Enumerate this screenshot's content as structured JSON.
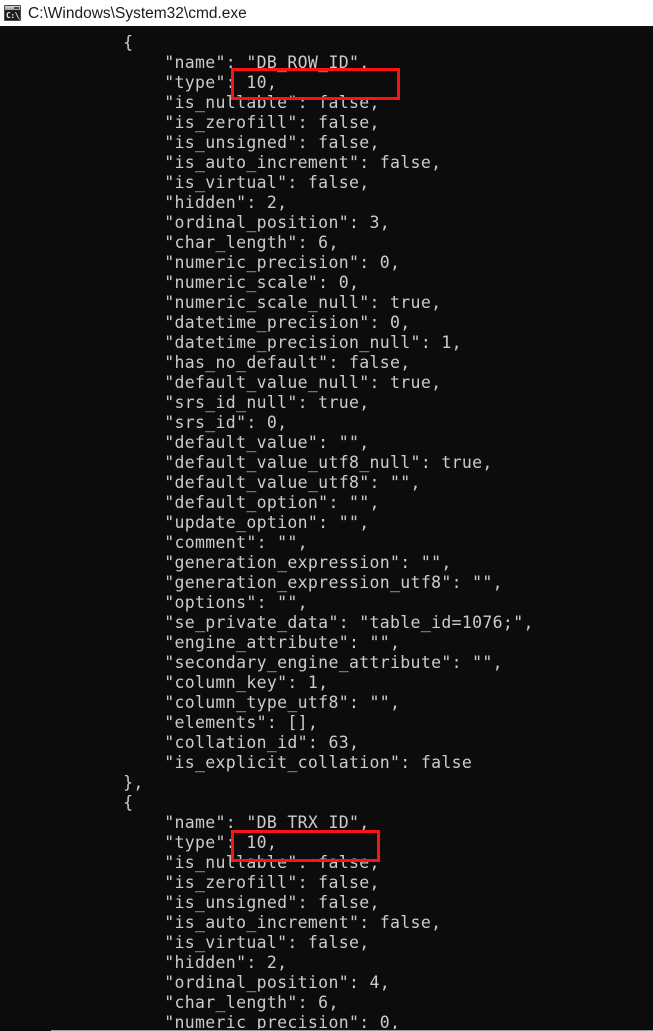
{
  "window": {
    "title": "C:\\Windows\\System32\\cmd.exe",
    "icon": "cmd-console-icon",
    "icon_glyph": "C:\\_",
    "background_color": "#0c0c0c",
    "text_color": "#cccccc",
    "titlebar_background": "#ffffff",
    "titlebar_text_color": "#1a1a1a"
  },
  "annotations": {
    "color": "#fa1414",
    "boxes": [
      {
        "label": "DB_ROW_ID-highlight",
        "target_text": "\"DB_ROW_ID\","
      },
      {
        "label": "DB_TRX_ID-highlight",
        "target_text": "\"DB_TRX_ID\","
      }
    ]
  },
  "console": {
    "content": "            {\n                \"name\": \"DB_ROW_ID\",\n                \"type\": 10,\n                \"is_nullable\": false,\n                \"is_zerofill\": false,\n                \"is_unsigned\": false,\n                \"is_auto_increment\": false,\n                \"is_virtual\": false,\n                \"hidden\": 2,\n                \"ordinal_position\": 3,\n                \"char_length\": 6,\n                \"numeric_precision\": 0,\n                \"numeric_scale\": 0,\n                \"numeric_scale_null\": true,\n                \"datetime_precision\": 0,\n                \"datetime_precision_null\": 1,\n                \"has_no_default\": false,\n                \"default_value_null\": true,\n                \"srs_id_null\": true,\n                \"srs_id\": 0,\n                \"default_value\": \"\",\n                \"default_value_utf8_null\": true,\n                \"default_value_utf8\": \"\",\n                \"default_option\": \"\",\n                \"update_option\": \"\",\n                \"comment\": \"\",\n                \"generation_expression\": \"\",\n                \"generation_expression_utf8\": \"\",\n                \"options\": \"\",\n                \"se_private_data\": \"table_id=1076;\",\n                \"engine_attribute\": \"\",\n                \"secondary_engine_attribute\": \"\",\n                \"column_key\": 1,\n                \"column_type_utf8\": \"\",\n                \"elements\": [],\n                \"collation_id\": 63,\n                \"is_explicit_collation\": false\n            },\n            {\n                \"name\": \"DB_TRX_ID\",\n                \"type\": 10,\n                \"is_nullable\": false,\n                \"is_zerofill\": false,\n                \"is_unsigned\": false,\n                \"is_auto_increment\": false,\n                \"is_virtual\": false,\n                \"hidden\": 2,\n                \"ordinal_position\": 4,\n                \"char_length\": 6,\n                \"numeric_precision\": 0,"
  }
}
